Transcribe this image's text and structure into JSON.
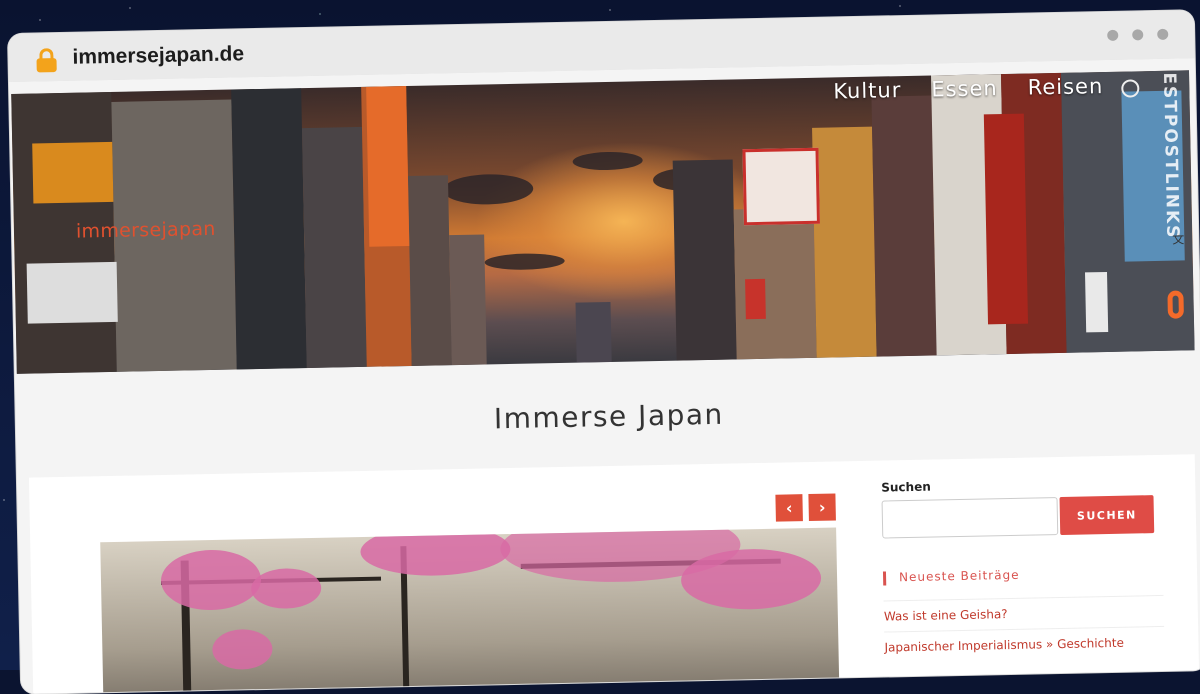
{
  "browser": {
    "url": "immersejapan.de"
  },
  "hero": {
    "brand": "immersejapan",
    "nav": [
      "Kultur",
      "Essen",
      "Reisen"
    ],
    "translate": "文",
    "badge_text": "GUESTPOSTLINKS"
  },
  "site_title": "Immerse Japan",
  "slider": {
    "prev": "‹",
    "next": "›"
  },
  "sidebar": {
    "search_label": "Suchen",
    "search_value": "",
    "search_button": "SUCHEN",
    "recent_title": "Neueste Beiträge",
    "recent_posts": [
      "Was ist eine Geisha?",
      "Japanischer Imperialismus » Geschichte"
    ]
  },
  "colors": {
    "accent": "#df4c46",
    "brand": "#e0512f",
    "lock": "#f3a31b"
  }
}
